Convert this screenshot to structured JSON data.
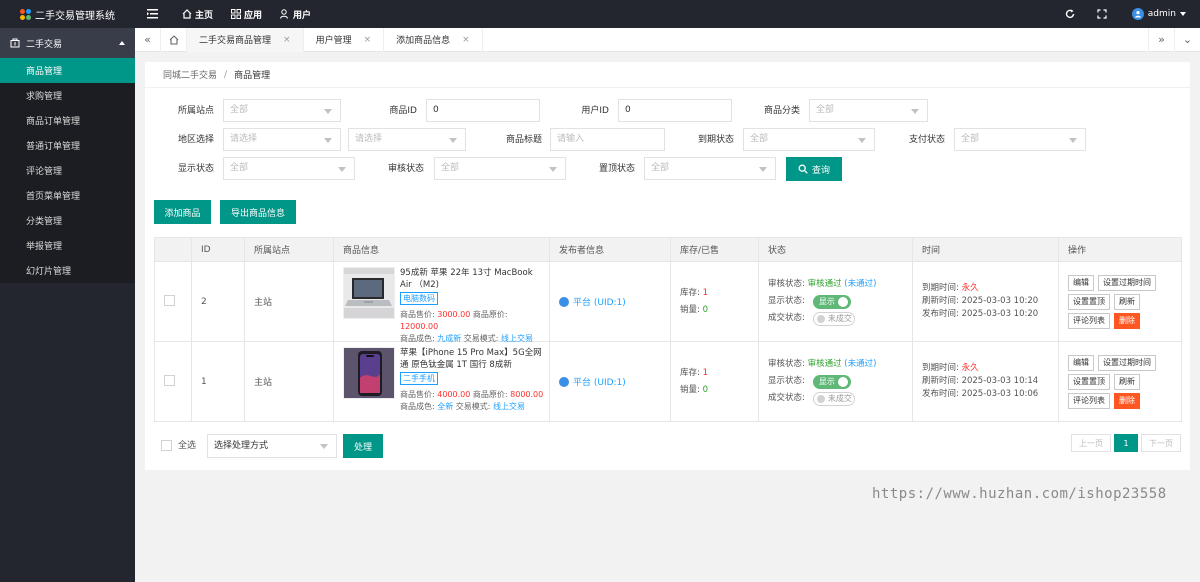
{
  "app": {
    "title": "二手交易管理系统",
    "nav": [
      "主页",
      "应用",
      "用户"
    ],
    "user": "admin",
    "logo_colors": [
      "#ff5722",
      "#1e9fff",
      "#ffb800",
      "#5fb878"
    ]
  },
  "sidebar": {
    "group": "二手交易",
    "items": [
      "商品管理",
      "求购管理",
      "商品订单管理",
      "普通订单管理",
      "评论管理",
      "首页菜单管理",
      "分类管理",
      "举报管理",
      "幻灯片管理"
    ]
  },
  "tabs": [
    "二手交易商品管理",
    "用户管理",
    "添加商品信息"
  ],
  "breadcrumb": [
    "同城二手交易",
    "商品管理"
  ],
  "filters": {
    "site": {
      "label": "所属站点",
      "value": "全部"
    },
    "goods_id": {
      "label": "商品ID",
      "value": "0"
    },
    "user_id": {
      "label": "用户ID",
      "value": "0"
    },
    "category": {
      "label": "商品分类",
      "value": "全部"
    },
    "region": {
      "label": "地区选择",
      "value1": "请选择",
      "value2": "请选择"
    },
    "title": {
      "label": "商品标题",
      "placeholder": "请输入"
    },
    "expire": {
      "label": "到期状态",
      "value": "全部"
    },
    "pay": {
      "label": "支付状态",
      "value": "全部"
    },
    "display": {
      "label": "显示状态",
      "value": "全部"
    },
    "audit": {
      "label": "审核状态",
      "value": "全部"
    },
    "top": {
      "label": "置顶状态",
      "value": "全部"
    },
    "query_button": "查询"
  },
  "actions": {
    "add": "添加商品",
    "export": "导出商品信息"
  },
  "table": {
    "headers": [
      "",
      "ID",
      "所属站点",
      "商品信息",
      "发布者信息",
      "库存/已售",
      "状态",
      "时间",
      "操作"
    ],
    "rows": [
      {
        "id": "2",
        "site": "主站",
        "title": "95成新 苹果 22年 13寸 MacBook Air （M2)",
        "tag": "电脑数码",
        "price_label": "商品售价:",
        "price": "3000.00",
        "orig_label": "商品原价:",
        "orig": "12000.00",
        "cond_label": "商品成色:",
        "cond": "九成新",
        "mode_label": "交易模式:",
        "mode": "线上交易",
        "publisher": "平台 (UID:1)",
        "stock_label": "库存:",
        "stock": "1",
        "sold_label": "销量:",
        "sold": "0",
        "audit_label": "审核状态:",
        "audit_value": "审核通过",
        "audit_link": "(未通过)",
        "display_label": "显示状态:",
        "display_value": "显示",
        "deal_label": "成交状态:",
        "deal_value": "未成交",
        "expire_label": "到期时间:",
        "expire": "永久",
        "refresh_label": "刷新时间:",
        "refresh": "2025-03-03 10:20",
        "publish_label": "发布时间:",
        "publish": "2025-03-03 10:20",
        "ops": [
          "编辑",
          "设置过期时间",
          "设置置顶",
          "刷新",
          "评论列表",
          "删除"
        ]
      },
      {
        "id": "1",
        "site": "主站",
        "title": "苹果【iPhone 15 Pro Max】5G全网通 原色钛金属 1T 国行 8成新",
        "tag": "二手手机",
        "price_label": "商品售价:",
        "price": "4000.00",
        "orig_label": "商品原价:",
        "orig": "8000.00",
        "cond_label": "商品成色:",
        "cond": "全新",
        "mode_label": "交易模式:",
        "mode": "线上交易",
        "publisher": "平台 (UID:1)",
        "stock_label": "库存:",
        "stock": "1",
        "sold_label": "销量:",
        "sold": "0",
        "audit_label": "审核状态:",
        "audit_value": "审核通过",
        "audit_link": "(未通过)",
        "display_label": "显示状态:",
        "display_value": "显示",
        "deal_label": "成交状态:",
        "deal_value": "未成交",
        "expire_label": "到期时间:",
        "expire": "永久",
        "refresh_label": "刷新时间:",
        "refresh": "2025-03-03 10:14",
        "publish_label": "发布时间:",
        "publish": "2025-03-03 10:06",
        "ops": [
          "编辑",
          "设置过期时间",
          "设置置顶",
          "刷新",
          "评论列表",
          "删除"
        ]
      }
    ]
  },
  "footer": {
    "select_all": "全选",
    "batch_select": "选择处理方式",
    "process": "处理",
    "pager": {
      "prev": "上一页",
      "current": "1",
      "next": "下一页"
    }
  },
  "watermark": "https://www.huzhan.com/ishop23558",
  "colors": {
    "accent": "#009688",
    "dark": "#23262e",
    "danger": "#ff5722",
    "link": "#1e9fff"
  }
}
